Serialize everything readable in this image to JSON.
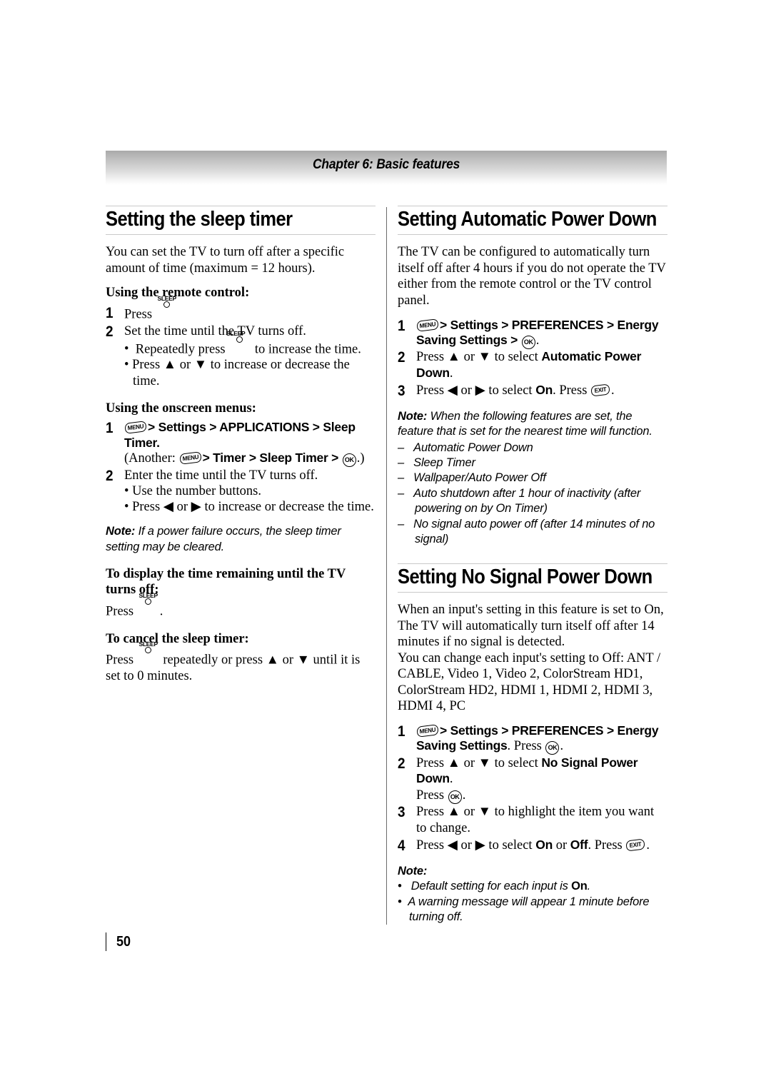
{
  "document": {
    "chapter_header": "Chapter 6: Basic features",
    "page_number": "50"
  },
  "icons": {
    "sleep": "SLEEP",
    "menu": "MENU",
    "ok": "OK",
    "exit": "EXIT",
    "up_arrow": "▲",
    "down_arrow": "▼",
    "left_arrow": "◀",
    "right_arrow": "▶"
  },
  "left_column": {
    "section": {
      "heading": "Setting the sleep timer",
      "intro": "You can set the TV to turn off after a specific amount of time (maximum = 12 hours).",
      "remote_subhead": "Using the remote control:",
      "remote_steps": [
        {
          "num": "1",
          "text_before": "Press ",
          "text_after": ""
        },
        {
          "num": "2",
          "text_before": "Set the time until the TV turns off.",
          "bullets": [
            "Repeatedly press  to increase the time.",
            "Press ▲ or ▼ to increase or decrease the time."
          ]
        }
      ],
      "step1_press": "Press",
      "step2_line": "Set the time until the TV turns off.",
      "step2_bullet1_pre": "Repeatedly press",
      "step2_bullet1_post": "to increase the time.",
      "step2_bullet2": "Press ▲ or ▼ to increase or decrease the time.",
      "onscreen_subhead": "Using the onscreen menus:",
      "os_step1_num": "1",
      "os_step1_path": "> Settings > APPLICATIONS > Sleep Timer.",
      "os_step1_another_open": "(Another:",
      "os_step1_another_mid": "> Timer > Sleep Timer >",
      "os_step1_another_close": ".)",
      "os_step2_num": "2",
      "os_step2_line": "Enter the time until the TV turns off.",
      "os_step2_bullet1": "Use the number buttons.",
      "os_step2_bullet2": "Press ◀ or ▶ to increase or decrease the time.",
      "note_label": "Note:",
      "note_text": "If a power failure occurs, the sleep timer setting may be cleared.",
      "display_subhead": "To display the time remaining until the TV turns off:",
      "display_press_pre": "Press",
      "display_press_post": ".",
      "cancel_subhead": "To cancel the sleep timer:",
      "cancel_pre": "Press",
      "cancel_post": "repeatedly or press ▲ or ▼ until it is set to 0 minutes."
    }
  },
  "right_column": {
    "section_auto": {
      "heading": "Setting Automatic Power Down",
      "intro": "The TV can be configured to automatically turn itself off after 4 hours if you do not operate the TV either from the remote control or the TV control panel.",
      "step1_num": "1",
      "step1_path": "> Settings > PREFERENCES > Energy Saving Settings >",
      "step1_end": ".",
      "step2_num": "2",
      "step2_pre": "Press ▲ or ▼ to select ",
      "step2_bold": "Automatic Power Down",
      "step2_post": ".",
      "step3_num": "3",
      "step3_pre": "Press ◀ or ▶ to select ",
      "step3_bold": "On",
      "step3_mid": ". Press ",
      "step3_post": ".",
      "note_label": "Note:",
      "note_text": "When the following features are set, the feature that is set for the nearest time will function.",
      "note_items": [
        "Automatic Power Down",
        "Sleep Timer",
        "Wallpaper/Auto Power Off",
        "Auto shutdown after 1 hour of inactivity (after powering on by On Timer)",
        "No signal auto power off (after 14 minutes of no signal)"
      ]
    },
    "section_nosignal": {
      "heading": "Setting No Signal Power Down",
      "intro1": "When an input's setting in this feature is set to On, The TV will automatically turn itself off after 14 minutes if no signal is detected.",
      "intro2": "You can change each input's setting to Off: ANT / CABLE, Video 1, Video 2, ColorStream HD1, ColorStream HD2, HDMI 1, HDMI 2, HDMI 3, HDMI 4, PC",
      "step1_num": "1",
      "step1_path": "> Settings > PREFERENCES > Energy Saving Settings",
      "step1_press": ". Press ",
      "step1_end": ".",
      "step2_num": "2",
      "step2_pre": "Press ▲ or ▼ to select ",
      "step2_bold": "No Signal Power Down",
      "step2_post": ".",
      "step2_press": "Press ",
      "step2_press_end": ".",
      "step3_num": "3",
      "step3_text": "Press ▲ or ▼ to highlight the item you want to change.",
      "step4_num": "4",
      "step4_pre": "Press ◀ or ▶ to select ",
      "step4_bold1": "On",
      "step4_mid": " or ",
      "step4_bold2": "Off",
      "step4_press": ". Press ",
      "step4_end": ".",
      "note_label": "Note:",
      "note_bullet1_pre": "Default setting for each input is ",
      "note_bullet1_bold": "On",
      "note_bullet1_post": ".",
      "note_bullet2": "A warning message will appear 1 minute before turning off."
    }
  }
}
